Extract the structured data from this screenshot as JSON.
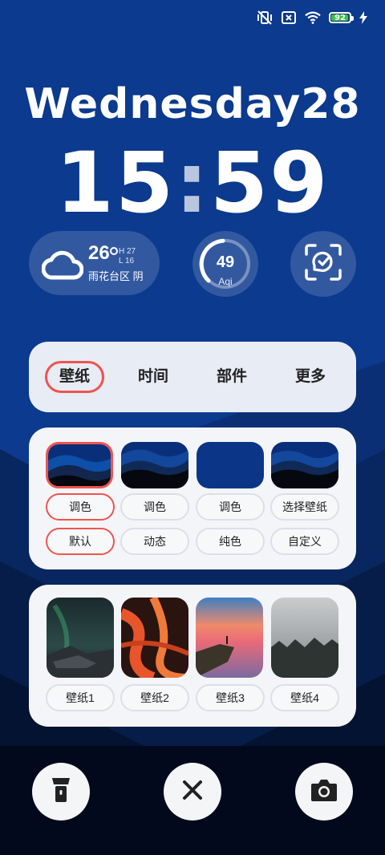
{
  "status_bar": {
    "icons": [
      "vibrate-off-icon",
      "no-sim-icon",
      "wifi-icon",
      "charging-bolt-icon"
    ],
    "battery_level": "92",
    "battery_color": "#39c33f"
  },
  "lock": {
    "day": "Wednesday28",
    "hour": "15",
    "minute": "59"
  },
  "weather": {
    "icon": "cloud-icon",
    "temp": "26",
    "high": "H 27",
    "low": "L 16",
    "location": "雨花台区 阴"
  },
  "aqi": {
    "value": "49",
    "label": "Aqi"
  },
  "scan": {
    "icon": "scan-icon"
  },
  "tabs": [
    {
      "label": "壁纸",
      "active": true
    },
    {
      "label": "时间",
      "active": false
    },
    {
      "label": "部件",
      "active": false
    },
    {
      "label": "更多",
      "active": false
    }
  ],
  "wallpaper_options": {
    "top_labels": [
      "调色",
      "调色",
      "调色",
      "选择壁纸"
    ],
    "bottom_labels": [
      "默认",
      "动态",
      "纯色",
      "自定义"
    ]
  },
  "wallpapers": {
    "labels": [
      "壁纸1",
      "壁纸2",
      "壁纸3",
      "壁纸4"
    ]
  },
  "bottom_buttons": {
    "left_icon": "flashlight-icon",
    "center_icon": "close-icon",
    "right_icon": "camera-icon"
  },
  "colors": {
    "accent": "#ef5350",
    "background": "#0b2f7e",
    "panel": "#f4f5f8"
  }
}
